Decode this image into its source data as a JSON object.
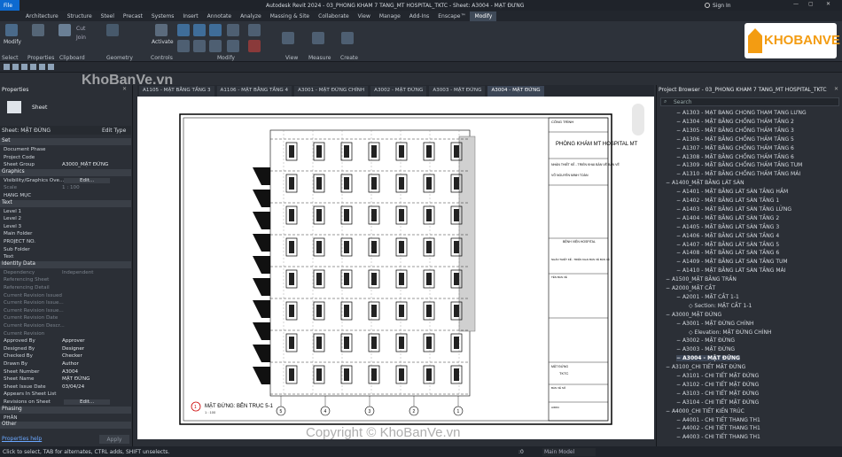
{
  "titlebar": {
    "app_button": "File",
    "title": "Autodesk Revit 2024 - 03_PHONG KHAM 7 TANG_MT HOSPITAL_TKTC - Sheet: A3004 - MẶT ĐỨNG",
    "signin": "Sign In"
  },
  "ribbon_tabs": [
    "Architecture",
    "Structure",
    "Steel",
    "Precast",
    "Systems",
    "Insert",
    "Annotate",
    "Analyze",
    "Massing & Site",
    "Collaborate",
    "View",
    "Manage",
    "Add-Ins",
    "Enscape™",
    "Modify"
  ],
  "active_tab": "Modify",
  "ribbon": {
    "modify": "Modify",
    "select": "Select",
    "properties": "Properties",
    "clipboard": "Clipboard",
    "cut": "Cut",
    "join": "Join",
    "paste": "Paste",
    "geometry": "Geometry",
    "activate": "Activate",
    "controls": "Controls",
    "modify_group": "Modify",
    "view": "View",
    "measure": "Measure",
    "create": "Create"
  },
  "properties": {
    "header": "Properties",
    "type": "Sheet",
    "selector": "Sheet: MẶT ĐỨNG",
    "edit_type": "Edit Type",
    "sections": [
      {
        "name": "Set",
        "rows": [
          [
            "Document Phase",
            ""
          ],
          [
            "Project Code",
            ""
          ],
          [
            "Sheet Group",
            "A3000_MẶT ĐỨNG"
          ]
        ]
      },
      {
        "name": "Graphics",
        "rows": [
          [
            "Visibility/Graphics Ove...",
            "Edit..."
          ],
          [
            "Scale",
            "1 : 100"
          ],
          [
            "HẠNG MỤC",
            ""
          ]
        ]
      },
      {
        "name": "Text",
        "rows": [
          [
            "Level 1",
            ""
          ],
          [
            "Level 2",
            ""
          ],
          [
            "Level 3",
            ""
          ],
          [
            "Main Folder",
            ""
          ],
          [
            "PROJECT NO.",
            ""
          ],
          [
            "Sub Folder",
            ""
          ],
          [
            "Text",
            ""
          ]
        ]
      },
      {
        "name": "Identity Data",
        "rows": [
          [
            "Dependency",
            "Independent"
          ],
          [
            "Referencing Sheet",
            ""
          ],
          [
            "Referencing Detail",
            ""
          ],
          [
            "Current Revision Issued",
            ""
          ],
          [
            "Current Revision Issue...",
            ""
          ],
          [
            "Current Revision Issue...",
            ""
          ],
          [
            "Current Revision Date",
            ""
          ],
          [
            "Current Revision Descr...",
            ""
          ],
          [
            "Current Revision",
            ""
          ],
          [
            "Approved By",
            "Approver"
          ],
          [
            "Designed By",
            "Designer"
          ],
          [
            "Checked By",
            "Checker"
          ],
          [
            "Drawn By",
            "Author"
          ],
          [
            "Sheet Number",
            "A3004"
          ],
          [
            "Sheet Name",
            "MẶT ĐỨNG"
          ],
          [
            "Sheet Issue Date",
            "03/04/24"
          ],
          [
            "Appears In Sheet List",
            ""
          ],
          [
            "Revisions on Sheet",
            "Edit..."
          ]
        ]
      },
      {
        "name": "Phasing",
        "rows": [
          [
            "PHÂN",
            ""
          ]
        ]
      },
      {
        "name": "Other",
        "rows": []
      }
    ],
    "help": "Properties help",
    "apply": "Apply"
  },
  "view_tabs": [
    "A1105 - MẶT BẰNG TẦNG 3",
    "A1106 - MẶT BẰNG TẦNG 4",
    "A3001 - MẶT ĐỨNG CHÍNH",
    "A3002 - MẶT ĐỨNG",
    "A3003 - MẶT ĐỨNG",
    "A3004 - MẶT ĐỨNG"
  ],
  "active_view": "A3004 - MẶT ĐỨNG",
  "sheet": {
    "view_title": "MẶT ĐỨNG: BÊN TRỤC 5-1",
    "view_scale": "1 : 100",
    "titleblock": [
      "CÔNG TRÌNH",
      "PHÒNG KHÁM MT HOSPITAL MT",
      "NHÀN THIẾT KẾ - TRIỂN KHAI BẢN VẼ BẢN VẼ",
      "VÕ NGUYÊN MINH TOÀN",
      "BỆNH VIỆN HOSPITAL",
      "NHÀN THIẾT KẾ - TRIỂN KHAI BẢN VẼ BẢN VẼ",
      "TÊN BẢN VẼ",
      "MẶT ĐỨNG",
      "TKTC",
      "BẢN VẼ SỐ",
      "A3004"
    ],
    "grids": [
      "5",
      "4",
      "3",
      "2",
      "1"
    ]
  },
  "project_browser": {
    "header": "Project Browser - 03_PHONG KHAM 7 TANG_MT HOSPITAL_TKTC",
    "search": "Search",
    "items": [
      {
        "t": "A1303 - MẶT BẰNG CHỐNG THẤM TẦNG LỬNG",
        "lvl": 2
      },
      {
        "t": "A1304 - MẶT BẰNG CHỐNG THẤM TẦNG 2",
        "lvl": 2
      },
      {
        "t": "A1305 - MẶT BẰNG CHỐNG THẤM TẦNG 3",
        "lvl": 2
      },
      {
        "t": "A1306 - MẶT BẰNG CHỐNG THẤM TẦNG 5",
        "lvl": 2
      },
      {
        "t": "A1307 - MẶT BẰNG CHỐNG THẤM TẦNG 6",
        "lvl": 2
      },
      {
        "t": "A1308 - MẶT BẰNG CHỐNG THẤM TẦNG 6",
        "lvl": 2
      },
      {
        "t": "A1309 - MẶT BẰNG CHỐNG THẤM TẦNG TUM",
        "lvl": 2
      },
      {
        "t": "A1310 - MẶT BẰNG CHỐNG THẤM TẦNG MÁI",
        "lvl": 2
      },
      {
        "t": "A1400_MẶT BẰNG LÁT SÀN",
        "lvl": 1
      },
      {
        "t": "A1401 - MẶT BẰNG LÁT SÀN TẦNG HẦM",
        "lvl": 2
      },
      {
        "t": "A1402 - MẶT BẰNG LÁT SÀN TẦNG 1",
        "lvl": 2
      },
      {
        "t": "A1403 - MẶT BẰNG LÁT SÀN TẦNG LỬNG",
        "lvl": 2
      },
      {
        "t": "A1404 - MẶT BẰNG LÁT SÀN TẦNG 2",
        "lvl": 2
      },
      {
        "t": "A1405 - MẶT BẰNG LÁT SÀN TẦNG 3",
        "lvl": 2
      },
      {
        "t": "A1406 - MẶT BẰNG LÁT SÀN TẦNG 4",
        "lvl": 2
      },
      {
        "t": "A1407 - MẶT BẰNG LÁT SÀN TẦNG 5",
        "lvl": 2
      },
      {
        "t": "A1408 - MẶT BẰNG LÁT SÀN TẦNG 6",
        "lvl": 2
      },
      {
        "t": "A1409 - MẶT BẰNG LÁT SÀN TẦNG TUM",
        "lvl": 2
      },
      {
        "t": "A1410 - MẶT BẰNG LÁT SÀN TẦNG MÁI",
        "lvl": 2
      },
      {
        "t": "A1500_MẶT BẰNG TRẦN",
        "lvl": 1
      },
      {
        "t": "A2000_MẶT CẮT",
        "lvl": 1
      },
      {
        "t": "A2001 - MẶT CẮT 1-1",
        "lvl": 2
      },
      {
        "t": "Section: MẶT CẮT 1-1",
        "lvl": 3
      },
      {
        "t": "A3000_MẶT ĐỨNG",
        "lvl": 1
      },
      {
        "t": "A3001 - MẶT ĐỨNG CHÍNH",
        "lvl": 2
      },
      {
        "t": "Elevation: MẶT ĐỨNG CHÍNH",
        "lvl": 3
      },
      {
        "t": "A3002 - MẶT ĐỨNG",
        "lvl": 2
      },
      {
        "t": "A3003 - MẶT ĐỨNG",
        "lvl": 2
      },
      {
        "t": "A3004 - MẶT ĐỨNG",
        "lvl": 2,
        "hl": true
      },
      {
        "t": "A3100_CHI TIẾT MẶT ĐỨNG",
        "lvl": 1
      },
      {
        "t": "A3101 - CHI TIẾT MẶT ĐỨNG",
        "lvl": 2
      },
      {
        "t": "A3102 - CHI TIẾT MẶT ĐỨNG",
        "lvl": 2
      },
      {
        "t": "A3103 - CHI TIẾT MẶT ĐỨNG",
        "lvl": 2
      },
      {
        "t": "A3104 - CHI TIẾT MẶT ĐỨNG",
        "lvl": 2
      },
      {
        "t": "A4000_CHI TIẾT KIẾN TRÚC",
        "lvl": 1
      },
      {
        "t": "A4001 - CHI TIẾT THANG TH1",
        "lvl": 2
      },
      {
        "t": "A4002 - CHI TIẾT THANG TH1",
        "lvl": 2
      },
      {
        "t": "A4003 - CHI TIẾT THANG TH1",
        "lvl": 2
      }
    ]
  },
  "status": {
    "hint": "Click to select, TAB for alternates, CTRL adds, SHIFT unselects.",
    "model": "Main Model",
    "zero": ":0"
  },
  "watermarks": {
    "top_left": "KhoBanVe.vn",
    "copyright": "Copyright © KhoBanVe.vn",
    "logo": "KHOBANVE"
  },
  "colors": {
    "accent": "#0d6ad0",
    "logo_orange": "#f39c12"
  }
}
